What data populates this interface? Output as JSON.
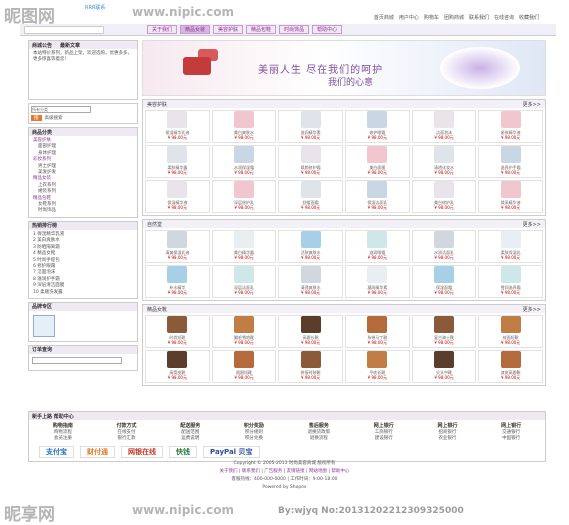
{
  "watermarks": {
    "top_left": "昵图网",
    "top_url": "www.nipic.com",
    "bottom_left": "昵享网",
    "bottom_url": "www.nipic.com",
    "bottom_right": "By:wjyq No:20131202212309325000"
  },
  "top": {
    "logo_hint": "RRR联系",
    "links": [
      "首页商城",
      "用户中心",
      "购物车",
      "团购商城",
      "联系我们",
      "在线咨询",
      "收藏我们"
    ]
  },
  "nav": {
    "items": [
      "关于我们",
      "精品女装",
      "美容护肤",
      "精品包鞋",
      "时尚饰品",
      "帮助中心"
    ]
  },
  "sidebar": {
    "notice_tabs": [
      "商城公告",
      "最新文章"
    ],
    "notice_text": "本站特价系列，新品上架，欢迎选购，优惠多多，更多惊喜等着您！",
    "search_placeholder": "所有分类",
    "search_btn": "搜",
    "advanced_search": "高级搜索",
    "categories_title": "商品分类",
    "categories": [
      "美容护肤",
      "面部护理",
      "身体护理",
      "彩妆系列",
      "男士护理",
      "美发护发",
      "精品女装",
      "上衣系列",
      "裙装系列",
      "精品包鞋",
      "女鞋系列",
      "时尚饰品"
    ],
    "ranking_title": "热销排行榜",
    "ranking": [
      "1 保湿精华乳液",
      "2 美白爽肤水",
      "3 防晒隔离霜",
      "4 精品女靴",
      "5 时尚手提包",
      "6 修护眼霜",
      "7 洁面泡沫",
      "8 滋润护手霜",
      "9 深层清洁面膜",
      "10 柔顺洗发露"
    ],
    "brand_title": "品牌专区",
    "order_title": "订单查询"
  },
  "main": {
    "banner_line1": "美丽人生 尽在我们的呵护",
    "banner_line2": "我们的心意",
    "sections": [
      {
        "title": "美容护肤",
        "more": "更多>>",
        "products": [
          "保湿精华乳液",
          "美白爽肤水",
          "滋润精华素",
          "修护眼霜",
          "洁面泡沫",
          "紧致精华液",
          "柔肤精华露",
          "水润保湿霜",
          "焕颜修护霜",
          "美白面膜",
          "清透化妆水",
          "滋养护手霜",
          "保湿精华液",
          "深层修护乳",
          "舒缓面霜",
          "保湿洁面乳",
          "美白修护乳",
          "焕采精华液"
        ]
      },
      {
        "title": "自然堂",
        "more": "更多>>",
        "products": [
          "清爽保湿乳液",
          "美白精华露",
          "活肤爽肤水",
          "滋润眼霜",
          "水润洁面乳",
          "柔肤保湿乳",
          "补水精华",
          "深层洁面乳",
          "清透爽肤水",
          "凝润精华素",
          "保湿面霜",
          "雪润滋养霜"
        ]
      },
      {
        "title": "精品女靴",
        "more": "更多>>",
        "products": [
          "时尚短靴",
          "翻毛雪地靴",
          "高跟长靴",
          "系带马丁靴",
          "复古骑士靴",
          "绒面短靴",
          "高筒皮靴",
          "粗跟短靴",
          "拼接时装靴",
          "平底长靴",
          "尖头中靴",
          "漆皮高跟靴"
        ]
      }
    ],
    "price": "¥ 98.00元"
  },
  "help": {
    "title": "新手上路 帮助中心",
    "columns": [
      {
        "head": "购物指南",
        "items": [
          "购物流程",
          "会员注册"
        ]
      },
      {
        "head": "付款方式",
        "items": [
          "在线支付",
          "银行汇款"
        ]
      },
      {
        "head": "配送服务",
        "items": [
          "配送范围",
          "运费说明"
        ]
      },
      {
        "head": "积分奖励",
        "items": [
          "积分规则",
          "积分兑换"
        ]
      },
      {
        "head": "售后服务",
        "items": [
          "退换货政策",
          "退换流程"
        ]
      },
      {
        "head": "网上银行",
        "items": [
          "工商银行",
          "建设银行"
        ]
      },
      {
        "head": "网上银行",
        "items": [
          "招商银行",
          "农业银行"
        ]
      },
      {
        "head": "网上银行",
        "items": [
          "交通银行",
          "中国银行"
        ]
      }
    ],
    "logos": [
      "支付宝",
      "财付通",
      "网银在线",
      "快钱",
      "PayPal 贝宝"
    ]
  },
  "footer": {
    "line1": "Copyright © 2005-2013 时尚美容商城 版权所有",
    "links": "关于我们 | 联系我们 | 广告服务 | 友情链接 | 网站地图 | 帮助中心",
    "line3": "客服热线：400-000-0000 | 工作时间：9:00-18:00",
    "powered": "Powered by Shopex"
  },
  "colors": {
    "accent": "#8a3a96",
    "price": "#cc0000",
    "nav_bg": "#f0eef7"
  }
}
